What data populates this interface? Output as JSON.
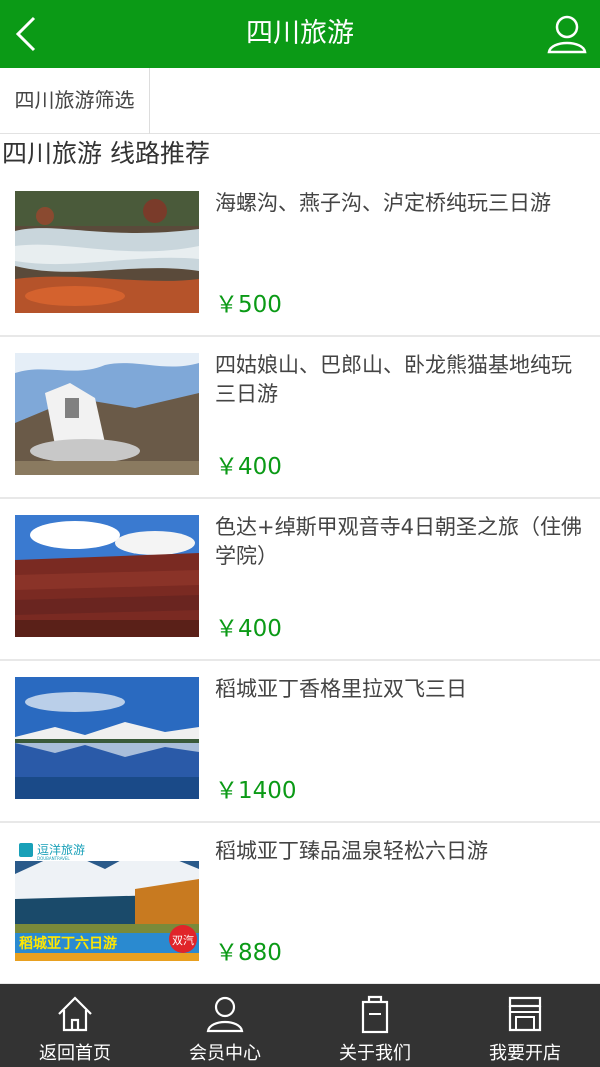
{
  "header": {
    "title": "四川旅游",
    "back_icon": "chevron-left-icon",
    "user_icon": "user-icon"
  },
  "filter": {
    "tab_label": "四川旅游筛选"
  },
  "section": {
    "title": "四川旅游 线路推荐"
  },
  "routes": [
    {
      "name": "海螺沟、燕子沟、泸定桥纯玩三日游",
      "price": "￥500"
    },
    {
      "name": "四姑娘山、巴郎山、卧龙熊猫基地纯玩三日游",
      "price": "￥400"
    },
    {
      "name": "色达+绰斯甲观音寺4日朝圣之旅（住佛学院）",
      "price": "￥400"
    },
    {
      "name": "稻城亚丁香格里拉双飞三日",
      "price": "￥1400"
    },
    {
      "name": "稻城亚丁臻品温泉轻松六日游",
      "price": "￥880"
    }
  ],
  "thumb5_overlay": {
    "brand": "逗洋旅游",
    "brand_sub": "DOUBANTRAVEL",
    "banner": "稻城亚丁六日游",
    "badge": "双汽"
  },
  "tabbar": {
    "items": [
      {
        "label": "返回首页",
        "icon": "home-icon"
      },
      {
        "label": "会员中心",
        "icon": "user-icon"
      },
      {
        "label": "关于我们",
        "icon": "document-icon"
      },
      {
        "label": "我要开店",
        "icon": "store-icon"
      }
    ]
  },
  "colors": {
    "brand_green": "#0b9a16",
    "tabbar_bg": "#333333",
    "price_green": "#0b9a16"
  }
}
